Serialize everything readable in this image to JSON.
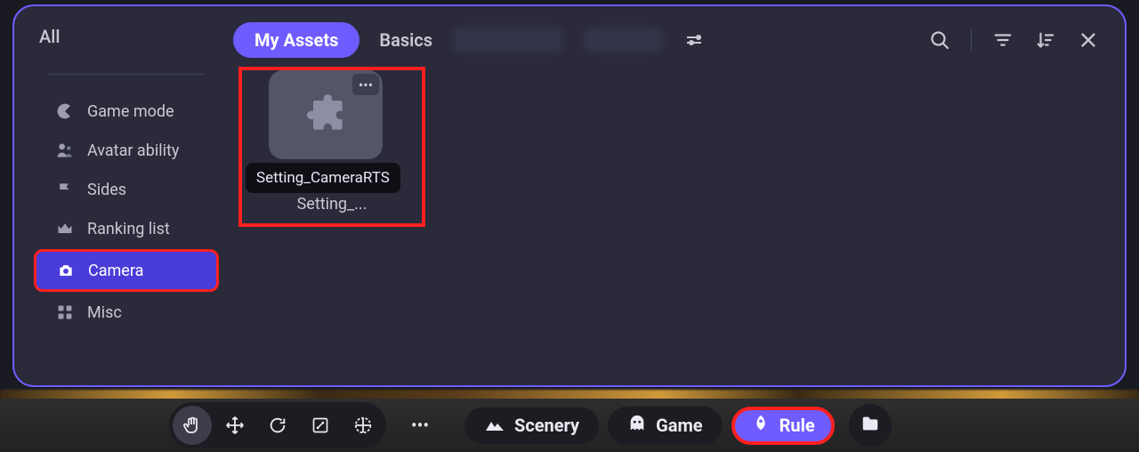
{
  "header": {
    "all_label": "All",
    "tabs": {
      "my_assets": "My Assets",
      "basics": "Basics"
    }
  },
  "sidebar": {
    "items": [
      {
        "label": "Game mode"
      },
      {
        "label": "Avatar ability"
      },
      {
        "label": "Sides"
      },
      {
        "label": "Ranking list"
      },
      {
        "label": "Camera"
      },
      {
        "label": "Misc"
      }
    ]
  },
  "asset": {
    "tooltip": "Setting_CameraRTS",
    "label": "Setting_..."
  },
  "toolbar": {
    "scenery": "Scenery",
    "game": "Game",
    "rule": "Rule"
  }
}
